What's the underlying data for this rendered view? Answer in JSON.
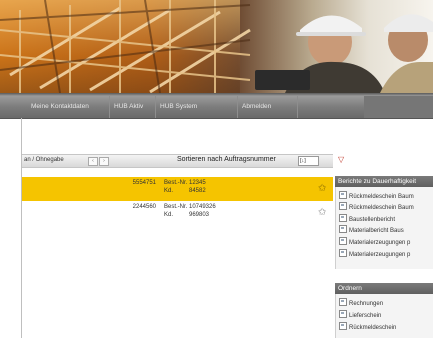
{
  "nav": {
    "items": [
      "Meine Kontaktdaten",
      "HUB Aktiv",
      "HUB System",
      "Abmelden"
    ]
  },
  "grid": {
    "filter_label": "an / Ohnegabe",
    "pager_prev": "‹",
    "pager_next": "›",
    "sort_label": "Sortieren nach Auftragsnummer",
    "sort_value": "[↓]",
    "rows": [
      {
        "number": "5554751",
        "label1": "Best.-Nr.",
        "value1": "12345",
        "label2": "Kd.",
        "value2": "84582",
        "selected": true
      },
      {
        "number": "2244560",
        "label1": "Best.-Nr.",
        "value1": "10749326",
        "label2": "Kd.",
        "value2": "969803",
        "selected": false
      }
    ]
  },
  "panels": [
    {
      "title": "Berichte zu Dauerhaftigkeit",
      "items": [
        "Rückmeldeschein Baum",
        "Rückmeldeschein Baum",
        "Baustellenbericht",
        "Materialbericht Baus",
        "Materialerzeugungen p",
        "Materialerzeugungen p"
      ]
    },
    {
      "title": "Ordnern",
      "items": [
        "Rechnungen",
        "Lieferschein",
        "Rückmeldeschein"
      ]
    }
  ],
  "icons": {
    "filter": "funnel-icon",
    "star": "star-icon",
    "doc": "document-icon"
  },
  "colors": {
    "accent": "#f5c400",
    "nav": "#7c7c7c",
    "panel_head": "#6a6a6a"
  }
}
